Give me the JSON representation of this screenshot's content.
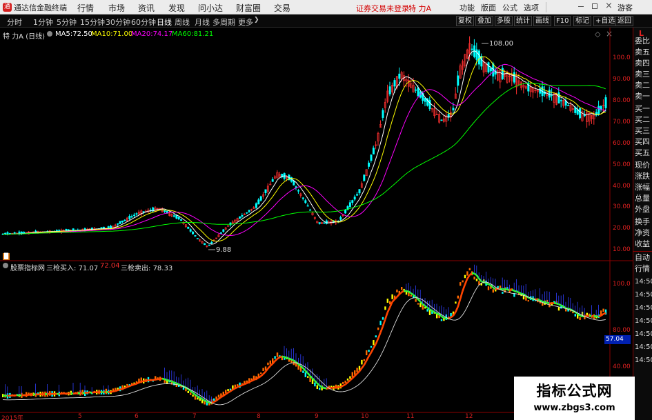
{
  "menubar": {
    "app_title": "通达信金融终端",
    "logo_glyph": "通",
    "items": [
      "行情",
      "市场",
      "资讯",
      "发现",
      "问小达",
      "财富圈",
      "交易"
    ],
    "login_notice": "证券交易未登录",
    "stock_name": "特 力A",
    "right_items": [
      "功能",
      "版面",
      "公式",
      "选项"
    ],
    "guest": "游客"
  },
  "periodbar": {
    "items": [
      "分时",
      "1分钟",
      "5分钟",
      "15分钟",
      "30分钟",
      "60分钟",
      "日线",
      "周线",
      "月线",
      "多周期",
      "更多"
    ],
    "active": "日线",
    "right_buttons": [
      "复权",
      "叠加",
      "多股",
      "统计",
      "画线",
      "F10",
      "标记",
      "+自选",
      "返回"
    ]
  },
  "main_chart": {
    "title": "特 力A (日线)",
    "ma": [
      {
        "label": "MA5:",
        "value": "72.50",
        "color": "#ffffff"
      },
      {
        "label": "MA10:",
        "value": "71.00",
        "color": "#ffff00"
      },
      {
        "label": "MA20:",
        "value": "74.17",
        "color": "#ff00ff"
      },
      {
        "label": "MA60:",
        "value": "81.21",
        "color": "#00ff00"
      }
    ],
    "yticks": [
      "100.0",
      "90.00",
      "80.00",
      "70.00",
      "60.00",
      "50.00",
      "40.00",
      "30.00",
      "20.00",
      "10.00"
    ],
    "high_label": "108.00",
    "low_label": "9.88"
  },
  "sub_chart": {
    "title": "股票指标网",
    "buy_label": "三枪买入:",
    "buy_value": "71.07",
    "mid_value": "72.04",
    "sell_label": "三枪卖出:",
    "sell_value": "78.33",
    "yticks": [
      "100.0",
      "80.00",
      "60.00",
      "40.00"
    ],
    "current_tag": "57.04"
  },
  "xaxis": [
    "2015年",
    "5",
    "6",
    "7",
    "8",
    "9",
    "10",
    "11",
    "12"
  ],
  "right_panel": {
    "corner": "L",
    "items": [
      "委比",
      "卖五",
      "卖四",
      "卖三",
      "卖二",
      "卖一",
      "买一",
      "买二",
      "买三",
      "买四",
      "买五",
      "现价",
      "涨跌",
      "涨幅",
      "总量",
      "外盘",
      "换手",
      "净资",
      "收益",
      "自动",
      "行情"
    ],
    "times": [
      "14:50",
      "14:50",
      "14:50",
      "14:50",
      "14:50",
      "14:50",
      "14:50"
    ]
  },
  "watermark": {
    "title": "指标公式网",
    "url": "www.zbgs3.com"
  },
  "colors": {
    "up": "#ff3030",
    "down": "#00ffff",
    "ma5": "#ffffff",
    "ma10": "#ffff00",
    "ma20": "#ff00ff",
    "ma60": "#00ff00",
    "axis": "#8b0000"
  }
}
